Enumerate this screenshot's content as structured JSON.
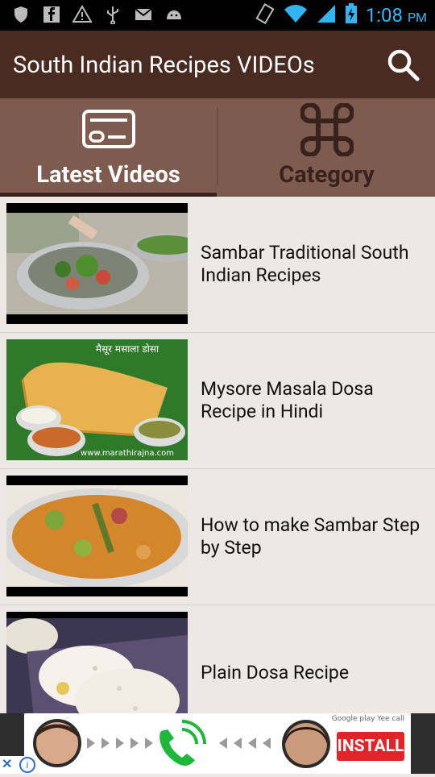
{
  "status_bar": {
    "time": "1:08",
    "ampm": "PM"
  },
  "appbar": {
    "title": "South Indian Recipes VIDEOs"
  },
  "tabs": [
    {
      "label": "Latest Videos",
      "icon": "video-card-icon",
      "selected": true
    },
    {
      "label": "Category",
      "icon": "command-icon",
      "selected": false
    }
  ],
  "videos": [
    {
      "title": "Sambar Traditional South Indian Recipes"
    },
    {
      "title": "Mysore Masala Dosa Recipe in Hindi",
      "thumb_text": "मैसूर मसाला डोसा",
      "thumb_footer": "www.marathirajna.com"
    },
    {
      "title": "How to make Sambar Step by Step"
    },
    {
      "title": "Plain Dosa Recipe"
    }
  ],
  "ad": {
    "install_label": "INSTALL",
    "badges": "Google play  Yee call"
  },
  "colors": {
    "appbar": "#4a2b22",
    "tabs": "#7d5b4f",
    "accent_time": "#32b4f0",
    "install": "#e0242a"
  }
}
